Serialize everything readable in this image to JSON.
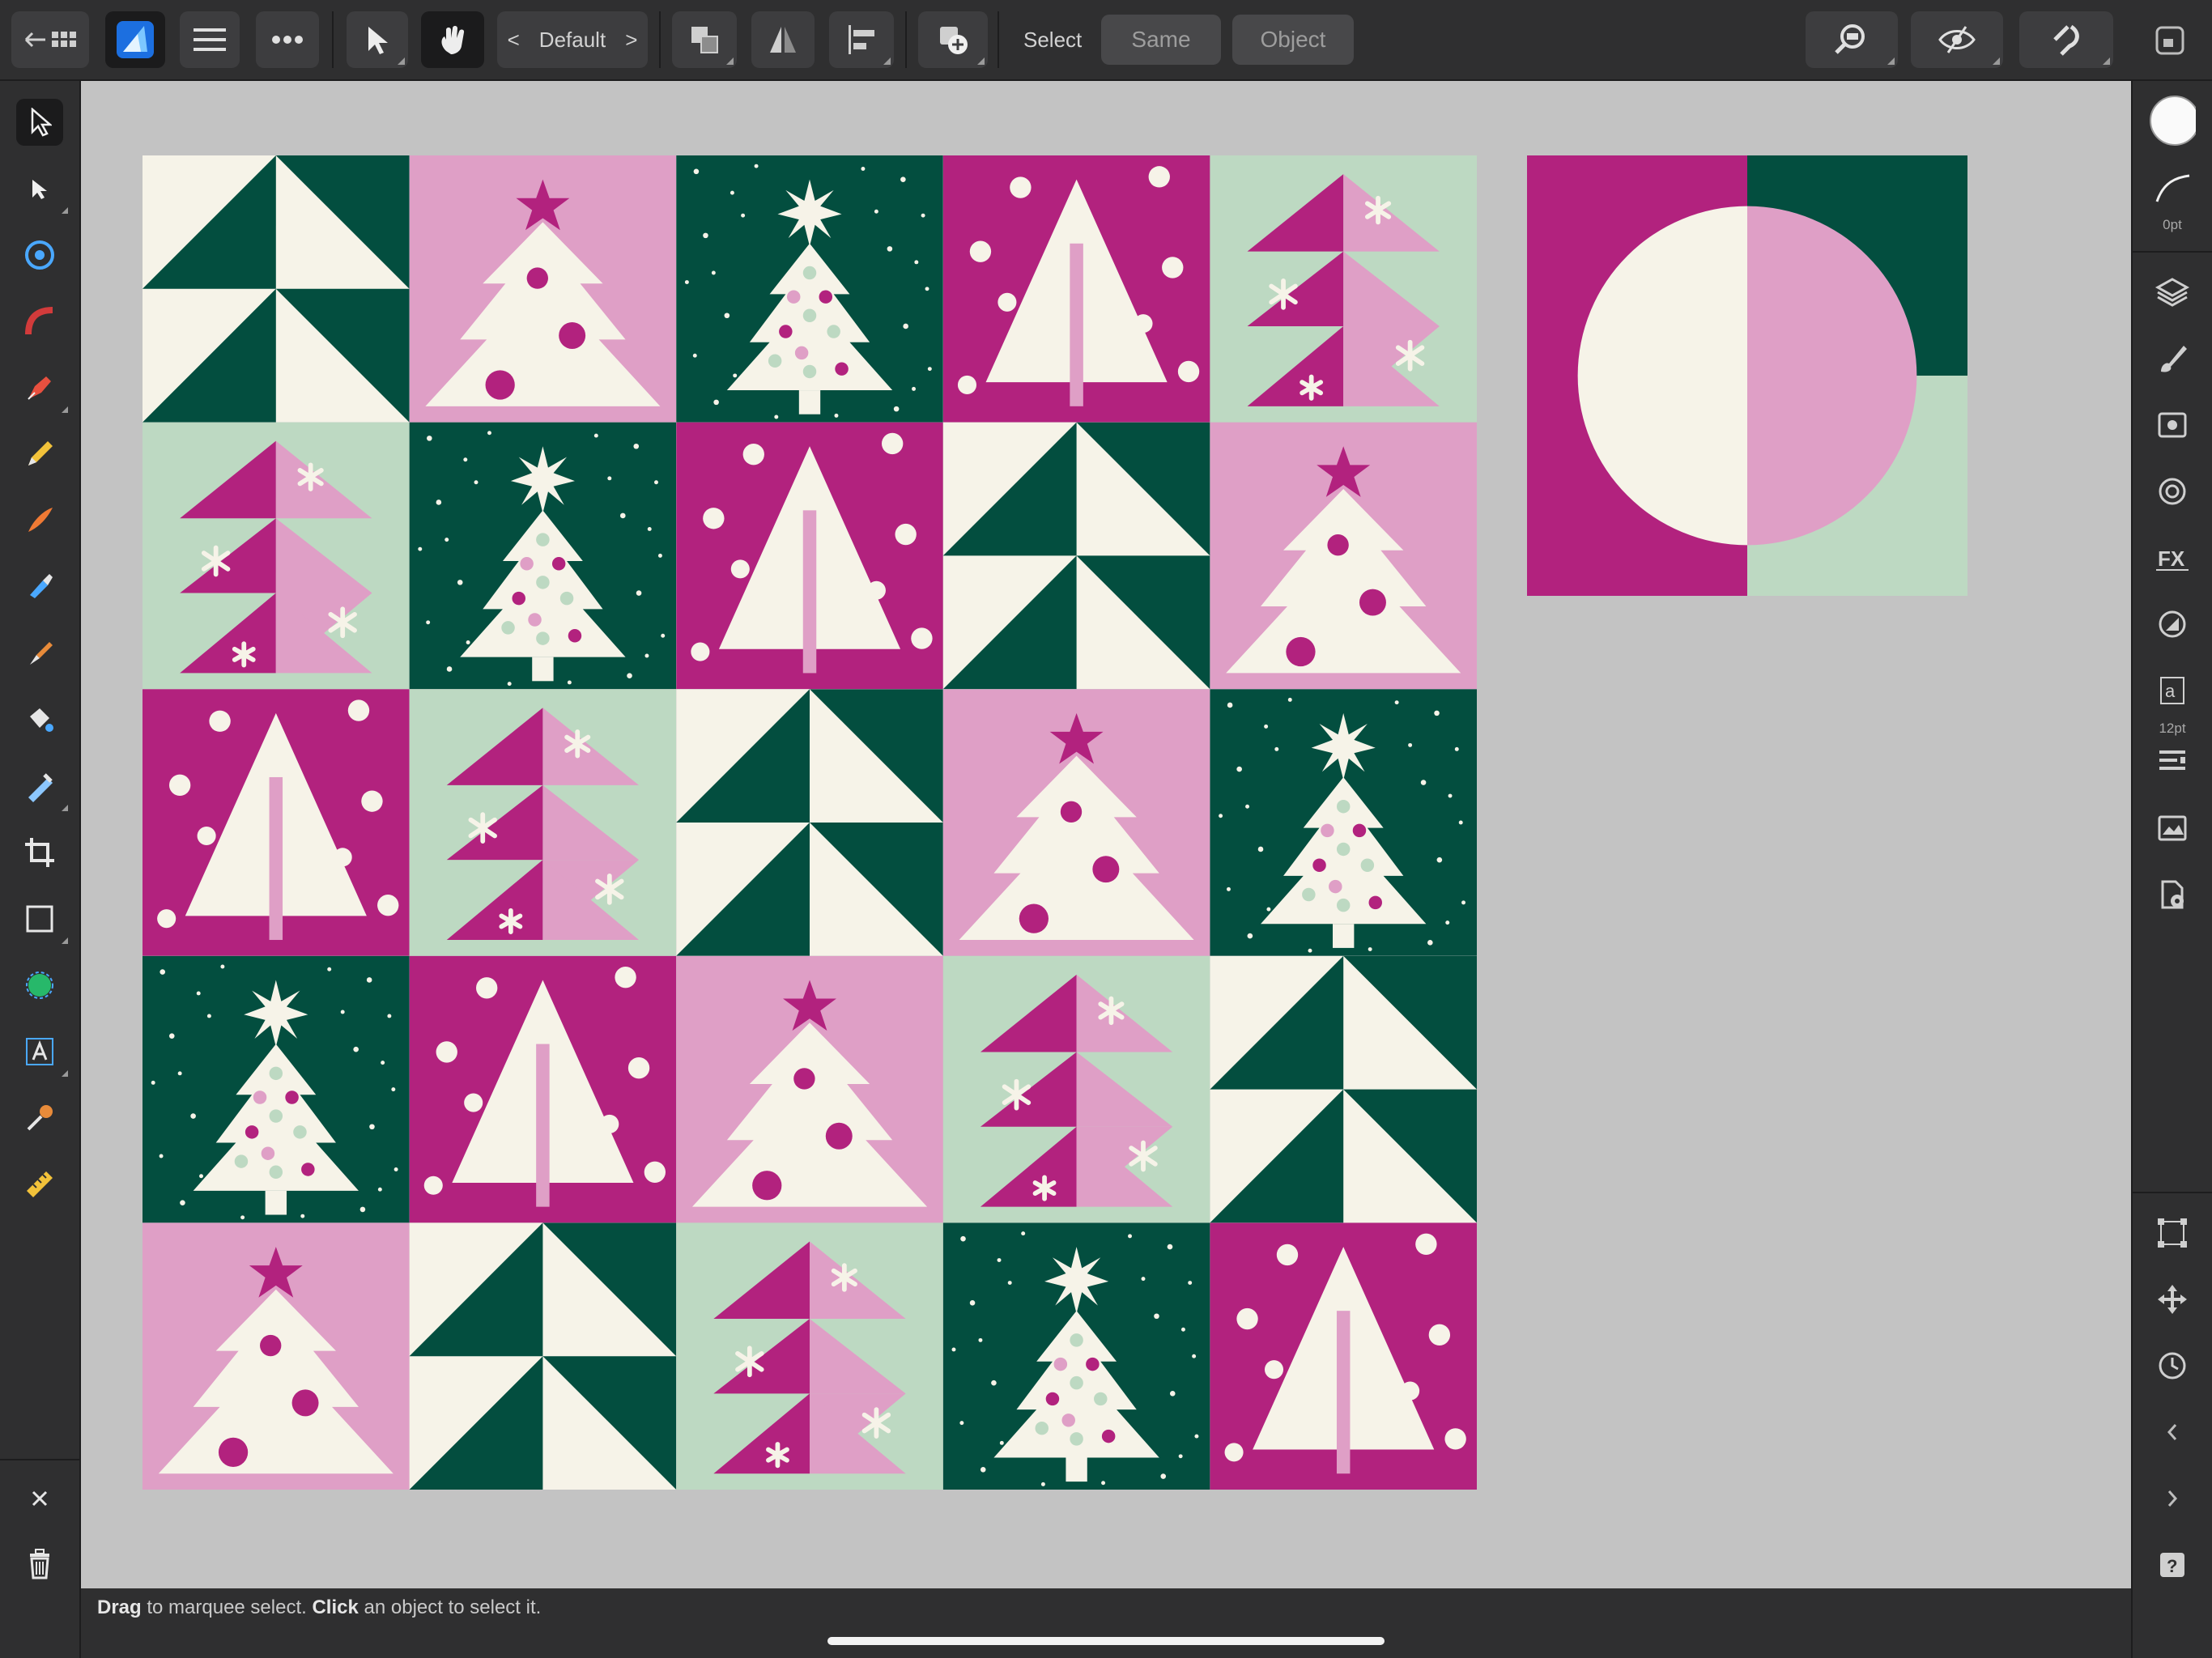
{
  "app": {
    "name": "Affinity Designer"
  },
  "toolbar": {
    "preset_label": "Default",
    "select_label": "Select",
    "same_label": "Same",
    "object_label": "Object"
  },
  "rightbar": {
    "stroke_width": "0pt",
    "font_size": "12pt"
  },
  "status": {
    "drag_word": "Drag",
    "drag_rest": " to marquee select. ",
    "click_word": "Click",
    "click_rest": " an object to select it."
  },
  "colors": {
    "magenta": "#b2227e",
    "pink": "#df9fc6",
    "dark_green": "#034e3f",
    "mint": "#bdd9c2",
    "cream": "#f6f3e8",
    "ui_bg": "#2f2f30",
    "canvas_bg": "#c3c3c3",
    "accent_blue": "#4aa8ff"
  },
  "artwork": {
    "grid_rows": [
      [
        "triangles",
        "pink-tree",
        "snow-tree",
        "magenta-tree",
        "mint-tree"
      ],
      [
        "mint-tree",
        "snow-tree",
        "magenta-tree",
        "triangles",
        "pink-tree"
      ],
      [
        "magenta-tree",
        "mint-tree",
        "triangles",
        "pink-tree",
        "snow-tree"
      ],
      [
        "snow-tree",
        "magenta-tree",
        "pink-tree",
        "mint-tree",
        "triangles"
      ],
      [
        "pink-tree",
        "triangles",
        "mint-tree",
        "snow-tree",
        "magenta-tree"
      ]
    ]
  }
}
